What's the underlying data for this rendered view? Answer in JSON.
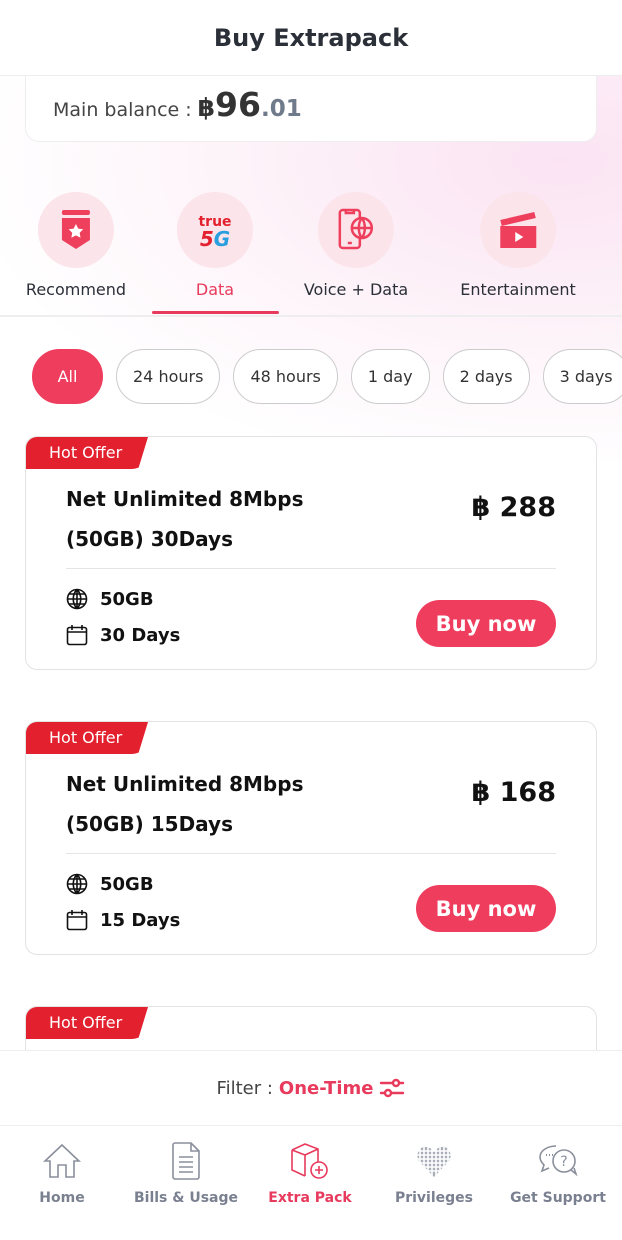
{
  "header": {
    "title": "Buy Extrapack"
  },
  "balance": {
    "label": "Main balance :",
    "currency": "฿",
    "integer": "96",
    "decimal": ".01"
  },
  "categories": [
    {
      "label": "Recommend",
      "icon": "ribbon-star-icon"
    },
    {
      "label": "Data",
      "icon": "true-5g-logo",
      "logo_text": "true 5G",
      "active": true
    },
    {
      "label": "Voice + Data",
      "icon": "phone-globe-icon"
    },
    {
      "label": "Entertainment",
      "icon": "clapperboard-icon"
    }
  ],
  "chips": [
    "All",
    "24 hours",
    "48 hours",
    "1 day",
    "2 days",
    "3 days"
  ],
  "active_chip": "All",
  "offers": [
    {
      "badge": "Hot Offer",
      "title": "Net Unlimited 8Mbps (50GB) 30Days",
      "price": "฿ 288",
      "data": "50GB",
      "duration": "30 Days",
      "button": "Buy now"
    },
    {
      "badge": "Hot Offer",
      "title": "Net Unlimited 8Mbps (50GB) 15Days",
      "price": "฿ 168",
      "data": "50GB",
      "duration": "15 Days",
      "button": "Buy now"
    },
    {
      "badge": "Hot Offer"
    }
  ],
  "filter": {
    "label": "Filter :",
    "value": "One-Time",
    "icon": "filter-sliders-icon"
  },
  "nav": [
    {
      "label": "Home",
      "icon": "home-icon"
    },
    {
      "label": "Bills & Usage",
      "icon": "document-icon"
    },
    {
      "label": "Extra Pack",
      "icon": "box-plus-icon",
      "active": true
    },
    {
      "label": "Privileges",
      "icon": "dotted-heart-icon"
    },
    {
      "label": "Get Support",
      "icon": "chat-question-icon"
    }
  ],
  "colors": {
    "accent": "#ef3d5e",
    "badge": "#e3202e",
    "inactive": "#7a8090"
  }
}
